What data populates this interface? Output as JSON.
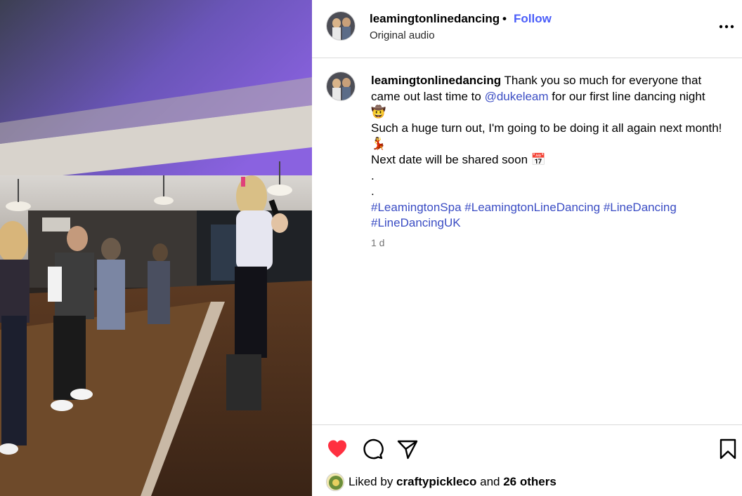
{
  "post": {
    "author": "leamingtonlinedancing",
    "separator": "•",
    "follow_label": "Follow",
    "audio": "Original audio",
    "more_icon": "more-options-icon"
  },
  "caption": {
    "author": "leamingtonlinedancing",
    "line1_pre": " Thank you so much for everyone that came out last time to ",
    "mention": "@dukeleam",
    "line1_post": " for our first line dancing night ",
    "emoji1": "🤠",
    "line2": "Such a huge turn out, I'm going to be doing it all again next month! ",
    "emoji2": "💃",
    "line3": "Next date will be shared soon ",
    "emoji3": "📅",
    "dot1": ".",
    "dot2": ".",
    "hashtags": [
      "#LeamingtonSpa",
      "#LeamingtonLineDancing",
      "#LineDancing",
      "#LineDancingUK"
    ],
    "time": "1 d"
  },
  "actions": {
    "like_color": "#ff3040",
    "icons": [
      "heart-icon",
      "comment-icon",
      "share-icon",
      "bookmark-icon"
    ]
  },
  "likes": {
    "prefix": "Liked by ",
    "user": "craftypickleco",
    "middle": " and ",
    "others": "26 others"
  },
  "colors": {
    "accent": "#4a5df9",
    "link": "#3b4dc4",
    "border": "#dbdbdb",
    "muted": "#737373"
  }
}
